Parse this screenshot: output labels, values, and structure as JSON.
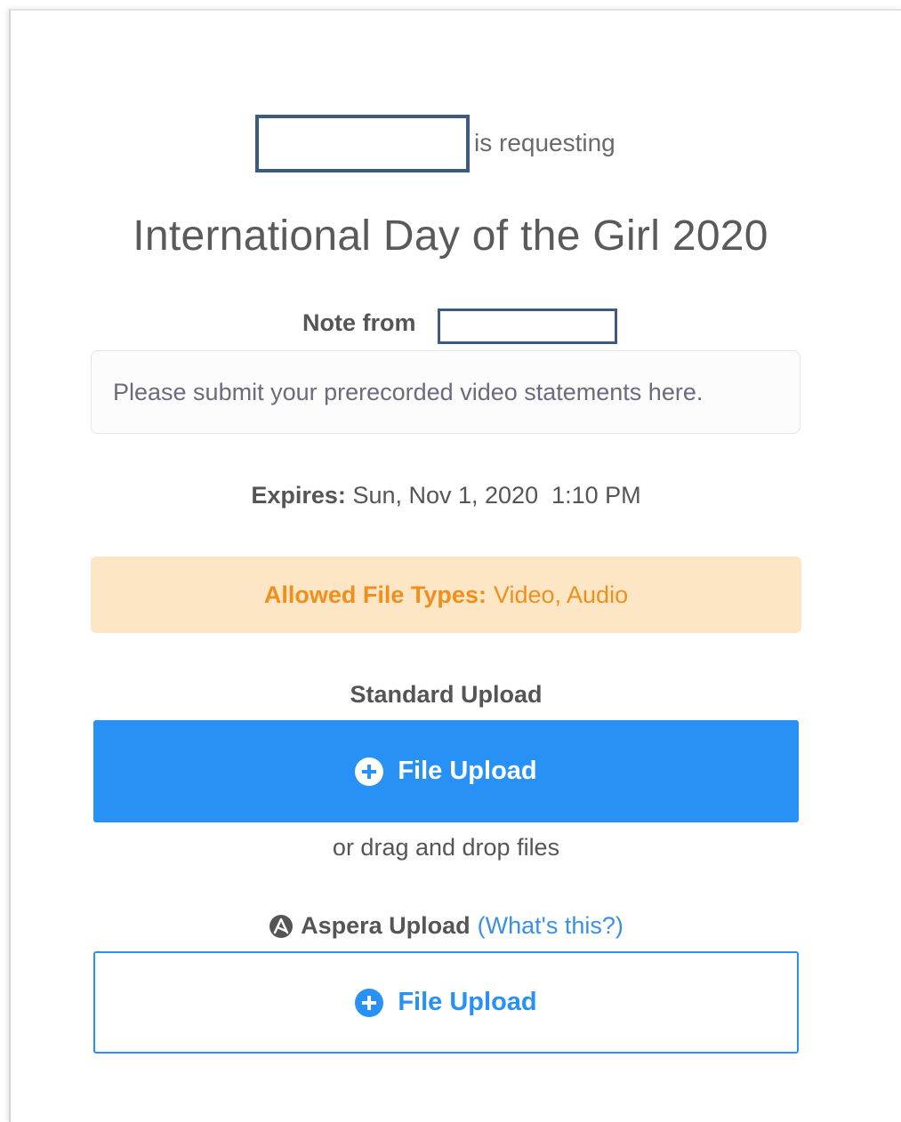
{
  "header": {
    "requesting_text": "is requesting"
  },
  "request": {
    "title": "International Day of the Girl 2020",
    "note_from_label": "Note from",
    "note_text": "Please submit your prerecorded video statements here.",
    "expires_label": "Expires:",
    "expires_value": "Sun, Nov 1, 2020  1:10 PM"
  },
  "allowed_types": {
    "label": "Allowed File Types:",
    "value": "Video, Audio"
  },
  "standard_upload": {
    "label": "Standard Upload",
    "button_label": "File Upload",
    "drag_text": "or drag and drop files"
  },
  "aspera_upload": {
    "label": "Aspera Upload",
    "help_link": "(What's this?)",
    "button_label": "File Upload"
  },
  "colors": {
    "primary": "#2891f5",
    "warning_bg": "#fde6c5",
    "warning_text": "#f0901c",
    "redaction_border": "#3d5a80"
  },
  "icons": {
    "upload": "plus-circle-icon",
    "aspera": "aspera-logo-icon"
  }
}
